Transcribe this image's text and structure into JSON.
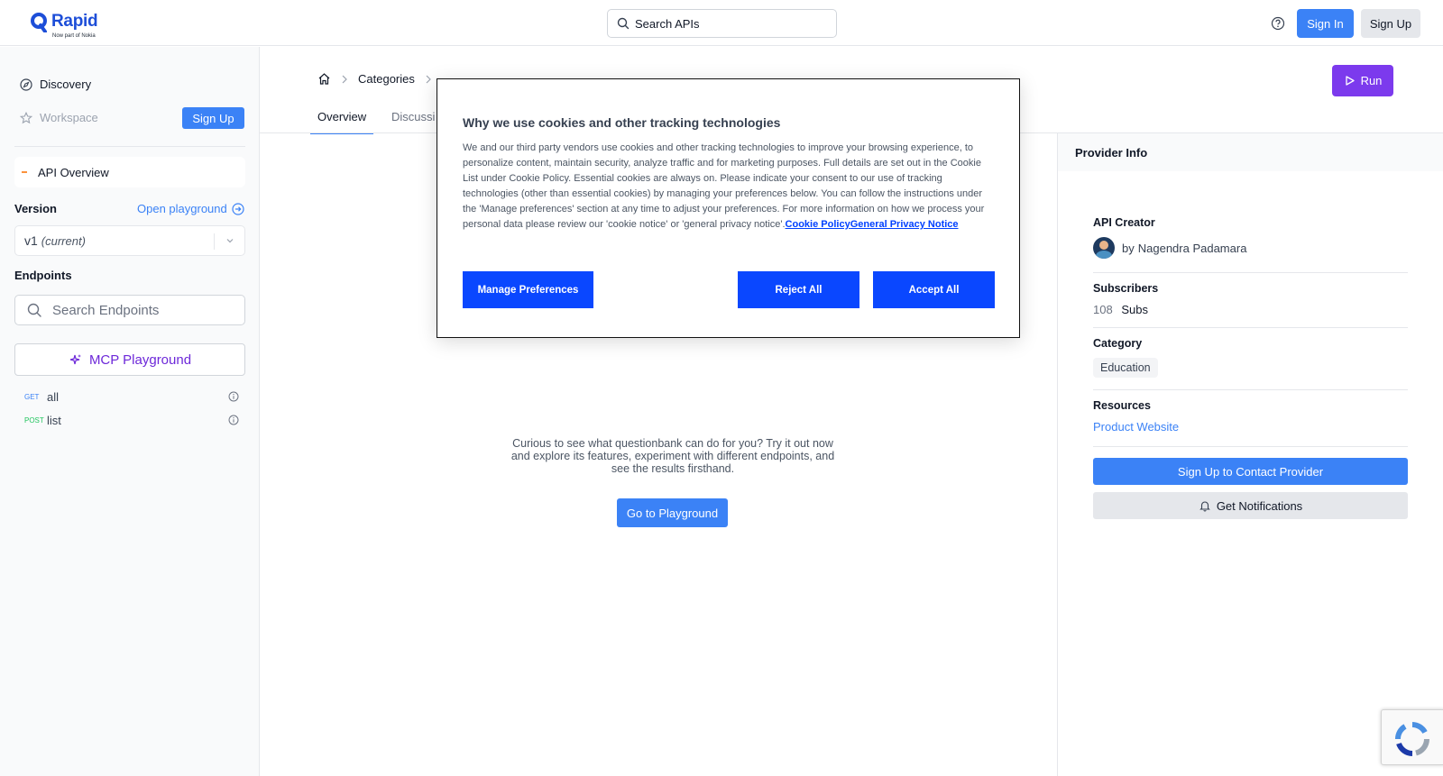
{
  "header": {
    "logo_word": "Rapid",
    "logo_sub": "Now part of Nokia",
    "search_placeholder": "Search APIs",
    "signin_label": "Sign In",
    "signup_label": "Sign Up"
  },
  "sidebar": {
    "discovery_label": "Discovery",
    "workspace_label": "Workspace",
    "signup_label": "Sign Up",
    "api_overview_label": "API Overview",
    "version_label": "Version",
    "open_playground_label": "Open playground",
    "version_value": "v1",
    "version_current": "(current)",
    "endpoints_label": "Endpoints",
    "search_endpoints_placeholder": "Search Endpoints",
    "mcp_label": "MCP Playground",
    "endpoints": [
      {
        "method": "GET",
        "name": "all"
      },
      {
        "method": "POST",
        "name": "list"
      }
    ]
  },
  "main": {
    "breadcrumb": {
      "categories": "Categories"
    },
    "run_label": "Run",
    "tabs": [
      {
        "label": "Overview"
      },
      {
        "label": "Discussi"
      }
    ],
    "curious_text": "Curious to see what questionbank can do for you? Try it out now and explore its features, experiment with different endpoints, and see the results firsthand.",
    "goto_label": "Go to Playground"
  },
  "provider": {
    "heading": "Provider Info",
    "creator_title": "API Creator",
    "creator_by": "by",
    "creator_name": "Nagendra Padamara",
    "subscribers_title": "Subscribers",
    "subscribers_count": "108",
    "subscribers_unit": "Subs",
    "category_title": "Category",
    "category_value": "Education",
    "resources_title": "Resources",
    "resources_link": "Product Website",
    "contact_label": "Sign Up to Contact Provider",
    "notif_label": "Get Notifications"
  },
  "cookie": {
    "title": "Why we use cookies and other tracking technologies",
    "body": "We and our third party vendors use cookies and other tracking technologies to improve your browsing experience, to personalize content, maintain security, analyze traffic and for marketing purposes. Full details are set out in the Cookie List under Cookie Policy. Essential cookies are always on. Please indicate your consent to our use of tracking technologies (other than essential cookies) by managing your preferences below. You can follow the instructions under the 'Manage preferences' section at any time to adjust your preferences. For more information on how we process your personal data please review our 'cookie notice' or 'general privacy notice'.",
    "link_cookie_policy": "Cookie Policy",
    "link_privacy": "General Privacy Notice",
    "manage_label": "Manage Preferences",
    "reject_label": "Reject All",
    "accept_label": "Accept All"
  },
  "colors": {
    "primary": "#3b82f6",
    "run": "#7c3aed",
    "cookie_button": "#0a47ff"
  }
}
